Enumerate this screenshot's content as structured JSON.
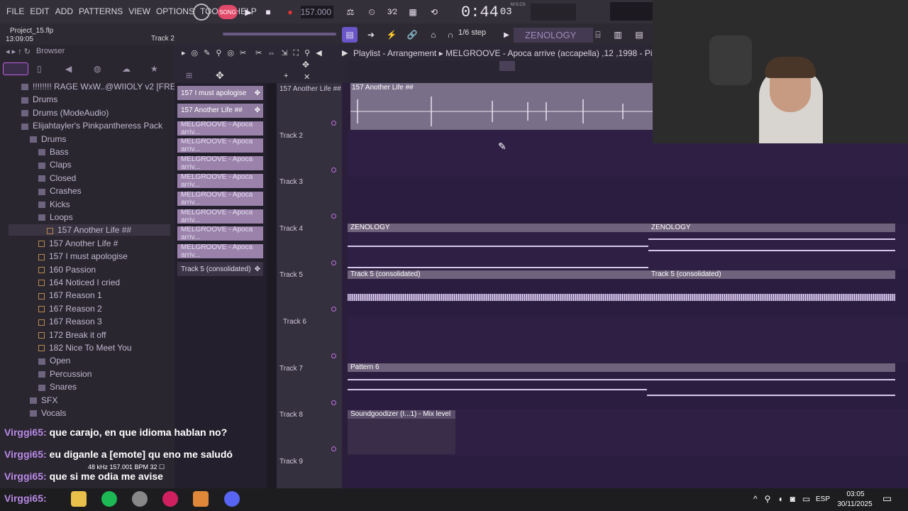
{
  "menu": [
    "FILE",
    "EDIT",
    "ADD",
    "PATTERNS",
    "VIEW",
    "OPTIONS",
    "TOOLS",
    "HELP"
  ],
  "transport": {
    "song_label": "SONG",
    "bpm": "157.000",
    "time": "0:44",
    "time_sub": "03",
    "time_unit": "M:S:CS"
  },
  "project": {
    "name": "Project_15.flp",
    "time": "13:09:05",
    "hint": "Track 2"
  },
  "toolbar2": {
    "snap": "1/6 step",
    "channel": "ZENOLOGY"
  },
  "browser": {
    "title": "Browser",
    "items": [
      {
        "label": "!!!!!!!! RAGE WxW..@WIIOLY v2 [FREE]",
        "indent": 1,
        "type": "folder"
      },
      {
        "label": "Drums",
        "indent": 1,
        "type": "folder"
      },
      {
        "label": "Drums (ModeAudio)",
        "indent": 1,
        "type": "folder"
      },
      {
        "label": "Elijahtayler's Pinkpantheress Pack",
        "indent": 1,
        "type": "folder"
      },
      {
        "label": "Drums",
        "indent": 2,
        "type": "folder"
      },
      {
        "label": "Bass",
        "indent": 3,
        "type": "folder"
      },
      {
        "label": "Claps",
        "indent": 3,
        "type": "folder"
      },
      {
        "label": "Closed",
        "indent": 3,
        "type": "folder"
      },
      {
        "label": "Crashes",
        "indent": 3,
        "type": "folder"
      },
      {
        "label": "Kicks",
        "indent": 3,
        "type": "folder"
      },
      {
        "label": "Loops",
        "indent": 3,
        "type": "folder"
      },
      {
        "label": "157 Another Life ##",
        "indent": 4,
        "type": "file"
      },
      {
        "label": "157 Another Life #",
        "indent": 3,
        "type": "file"
      },
      {
        "label": "157 I must apologise",
        "indent": 3,
        "type": "file"
      },
      {
        "label": "160 Passion",
        "indent": 3,
        "type": "file"
      },
      {
        "label": "164 Noticed I cried",
        "indent": 3,
        "type": "file"
      },
      {
        "label": "167 Reason 1",
        "indent": 3,
        "type": "file"
      },
      {
        "label": "167 Reason 2",
        "indent": 3,
        "type": "file"
      },
      {
        "label": "167 Reason 3",
        "indent": 3,
        "type": "file"
      },
      {
        "label": "172 Break it off",
        "indent": 3,
        "type": "file"
      },
      {
        "label": "182 Nice To Meet You",
        "indent": 3,
        "type": "file"
      },
      {
        "label": "Open",
        "indent": 3,
        "type": "folder"
      },
      {
        "label": "Percussion",
        "indent": 3,
        "type": "folder"
      },
      {
        "label": "Snares",
        "indent": 3,
        "type": "folder"
      },
      {
        "label": "SFX",
        "indent": 2,
        "type": "folder"
      },
      {
        "label": "Vocals",
        "indent": 2,
        "type": "folder"
      }
    ]
  },
  "patterns": [
    "157 I must apologise",
    "157 Another Life ##",
    "MELGROOVE - Apoca arriv...",
    "MELGROOVE - Apoca arriv...",
    "MELGROOVE - Apoca arriv...",
    "MELGROOVE - Apoca arriv...",
    "MELGROOVE - Apoca arriv...",
    "MELGROOVE - Apoca arriv...",
    "MELGROOVE - Apoca arriv...",
    "MELGROOVE - Apoca arriv...",
    "Track 5 (consolidated)"
  ],
  "playlist": {
    "title": "Playlist - Arrangement",
    "subtitle": "MELGROOVE - Apoca arrive (accapella) ,12 ,1998 - Pi",
    "tracks": [
      "157 Another Life ##",
      "Track 2",
      "Track 3",
      "Track 4",
      "Track 5",
      "Track 6",
      "Track 7",
      "Track 8",
      "Track 9"
    ],
    "clips": {
      "t1": "157 Another Life ##",
      "t4a": "ZENOLOGY",
      "t4b": "ZENOLOGY",
      "t5a": "Track 5 (consolidated)",
      "t5b": "Track 5 (consolidated)",
      "t7": "Pattern 6",
      "t8": "Soundgoodizer (I...1) - Mix level"
    }
  },
  "chat": [
    {
      "name": "Virggi65:",
      "msg": "que carajo, en que idioma hablan no?"
    },
    {
      "name": "Virggi65:",
      "msg": "eu diganle a [emote] qu eno me saludó"
    },
    {
      "name": "Virggi65:",
      "msg": "que si me odia me avise"
    }
  ],
  "chat_overlay": "48 kHz 157.001 BPM 32 ☐",
  "chat_label": "Virggi65:",
  "systray": {
    "lang": "ESP",
    "time": "03:05",
    "date": "30/11/2025"
  }
}
